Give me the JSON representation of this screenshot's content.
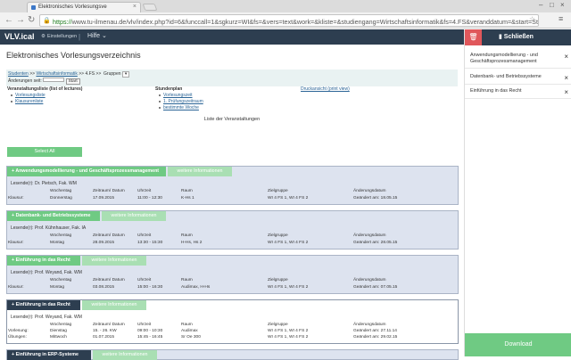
{
  "browser": {
    "tab_title": "Elektronisches Vorlesungsve",
    "url_scheme": "https://",
    "url_host": "www.tu-ilmenau.de",
    "url_rest": "/vlv/index.php?id=6&funccall=1&sgkurz=WI&fs=&vers=text&work=&kliste=&studiengang=Wirtschaftsinformatik&fs=4.FS&veranddatum=&start=Start"
  },
  "app": {
    "brand": "VLV.ical",
    "settings_label": "Einstellungen",
    "separator": "|",
    "help_label": "Hilfe ⌄"
  },
  "panel": {
    "close_label": "Schließen",
    "items": [
      {
        "label": "Anwendungsmodellierung - und Geschäftsprozessmanagement"
      },
      {
        "label": "Datenbank- und Betriebssysteme"
      },
      {
        "label": "Einführung in das Recht"
      }
    ],
    "download_label": "Download"
  },
  "main": {
    "title": "Elektronisches Vorlesungsverzeichnis",
    "breadcrumb_a": "Studenten",
    "breadcrumb_sep": ">>",
    "breadcrumb_b": "Wirtschaftsinformatik",
    "breadcrumb_c": ">> 4.FS >>",
    "gruppen_label": "Gruppen",
    "gruppen_value": "▾",
    "aenderungen_label": "Änderungen seit:",
    "start_label": "Start",
    "list_heading": "Veranstaltungsliste (list of lectures)",
    "list_items": [
      "Vorlesungsliste",
      "Klausurenliste"
    ],
    "plan_heading": "Stundenplan",
    "plan_items": [
      "Vorlesungszeit",
      "1. Prüfungszeitraum",
      "bestimmte Woche"
    ],
    "print_label": "Druckansicht (print view)",
    "list_title": "Liste der Veranstaltungen",
    "select_all": "Select All",
    "more_info": "weitere Informationen"
  },
  "table_headers": [
    "Wochentag",
    "Zeitraum/ Datum",
    "Uhrzeit",
    "Raum",
    "Zielgruppe",
    "Änderungsdatum"
  ],
  "courses": [
    {
      "title": "+ Anwendungsmodellierung - und Geschäftsprozessmanagement",
      "lecturer": "Lesende(r): Dr. Pietsch, Fak. WM",
      "rows": [
        {
          "type": "Klausur:",
          "day": "Donnerstag",
          "date": "17.09.2015",
          "time": "11:00 - 12:30",
          "room": "K-Hs 1",
          "group": "WI 4 FS 1, WI 4 FS 2",
          "changed": "Geändert am: 18.05.15"
        }
      ]
    },
    {
      "title": "+ Datenbank- und Betriebssysteme",
      "lecturer": "Lesende(r): Prof. Kühnhauser, Fak. IA",
      "rows": [
        {
          "type": "Klausur:",
          "day": "Montag",
          "date": "28.09.2015",
          "time": "13:30 - 15:30",
          "room": "H-Hs, Hs 2",
          "group": "WI 4 FS 1, WI 4 FS 2",
          "changed": "Geändert am: 28.05.15"
        }
      ]
    },
    {
      "title": "+ Einführung in das Recht",
      "lecturer": "Lesende(r): Prof. Weyand, Fak. WM",
      "rows": [
        {
          "type": "Klausur:",
          "day": "Montag",
          "date": "03.08.2015",
          "time": "15:00 - 16:30",
          "room": "Audimax, H-Hs",
          "group": "WI 4 FS 1, WI 4 FS 2",
          "changed": "Geändert am: 07.05.15"
        }
      ]
    },
    {
      "title": "+ Einführung in das Recht",
      "lecturer": "Lesende(r): Prof. Weyand, Fak. WM",
      "rows": [
        {
          "type": "Vorlesung:",
          "day": "Dienstag",
          "date": "15. - 26. KW",
          "time": "09:00 - 10:30",
          "room": "Audimax",
          "group": "WI 4 FS 1, WI 4 FS 2",
          "changed": "Geändert am: 27.11.14"
        },
        {
          "type": "Übungen:",
          "day": "Mittwoch",
          "date": "01.07.2015",
          "time": "15:45 - 16:45",
          "room": "Sr Oe 300",
          "group": "WI 4 FS 1, WI 4 FS 2",
          "changed": "Geändert am: 29.02.15"
        }
      ]
    },
    {
      "title": "+ Einführung in ERP-Systeme",
      "lecturer": "",
      "rows": []
    }
  ]
}
